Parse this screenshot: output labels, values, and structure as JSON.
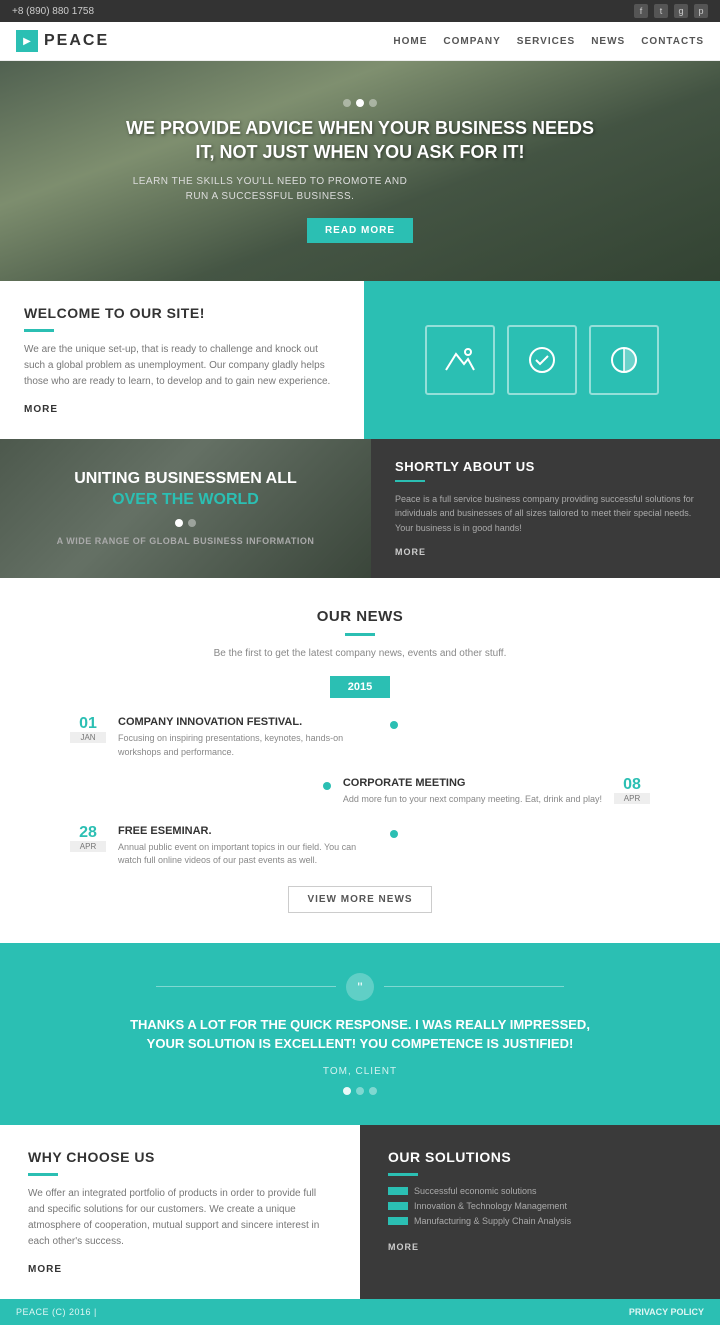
{
  "topbar": {
    "phone": "+8 (890) 880 1758",
    "social": [
      "f",
      "t",
      "g+",
      "p"
    ]
  },
  "header": {
    "logo_text": "PEACE",
    "nav": [
      {
        "label": "HOME"
      },
      {
        "label": "COMPANY"
      },
      {
        "label": "SERVICES"
      },
      {
        "label": "NEWS"
      },
      {
        "label": "CONTACTS"
      }
    ]
  },
  "hero": {
    "title": "WE PROVIDE ADVICE WHEN YOUR BUSINESS NEEDS IT, NOT JUST WHEN YOU ASK FOR IT!",
    "subtitle": "LEARN THE SKILLS YOU'LL NEED TO PROMOTE AND RUN A SUCCESSFUL BUSINESS.",
    "btn_label": "READ MORE"
  },
  "welcome": {
    "title": "WELCOME TO OUR SITE!",
    "text": "We are the unique set-up, that is ready to challenge and knock out such a global problem as unemployment. Our company gladly helps those who are ready to learn, to develop and to gain new experience.",
    "more": "MORE",
    "icons": [
      "mountain-icon",
      "check-circle-icon",
      "half-circle-icon"
    ]
  },
  "mid": {
    "left_title_line1": "UNITING BUSINESSMEN ALL",
    "left_title_highlight": "OVER THE WORLD",
    "left_subtitle": "A WIDE RANGE OF GLOBAL BUSINESS INFORMATION",
    "right_title": "SHORTLY ABOUT US",
    "right_text": "Peace is a full service business company providing successful solutions for individuals and businesses of all sizes tailored to meet their special needs. Your business is in good hands!",
    "right_more": "MORE"
  },
  "news": {
    "title": "OUR NEWS",
    "subtitle": "Be the first to get the latest company news, events and other stuff.",
    "year": "2015",
    "items": [
      {
        "day": "01",
        "month": "JAN",
        "title": "COMPANY INNOVATION FESTIVAL.",
        "text": "Focusing on inspiring presentations, keynotes, hands-on workshops and performance."
      },
      {
        "day": "08",
        "month": "APR",
        "title": "CORPORATE MEETING",
        "text": "Add more fun to your next company meeting. Eat, drink and play!"
      },
      {
        "day": "28",
        "month": "APR",
        "title": "FREE ESEMINAR.",
        "text": "Annual public event on important topics in our field. You can watch full online videos of our past events as well."
      }
    ],
    "view_more": "VIEW MORE NEWS"
  },
  "testimonial": {
    "text": "THANKS A LOT FOR THE QUICK RESPONSE. I WAS REALLY IMPRESSED, YOUR SOLUTION IS EXCELLENT! YOU COMPETENCE IS JUSTIFIED!",
    "author": "TOM, CLIENT"
  },
  "bottom": {
    "left_title": "WHY CHOOSE US",
    "left_text": "We offer an integrated portfolio of products in order to provide full and specific solutions for our customers. We create a unique atmosphere of cooperation, mutual support and sincere interest in each other's success.",
    "left_more": "MORE",
    "right_title": "OUR SOLUTIONS",
    "solutions": [
      "Successful economic solutions",
      "Innovation & Technology Management",
      "Manufacturing & Supply Chain Analysis"
    ],
    "right_more": "MORE"
  },
  "footer": {
    "copyright": "PEACE (C) 2016 |",
    "privacy": "PRIVACY POLICY"
  }
}
